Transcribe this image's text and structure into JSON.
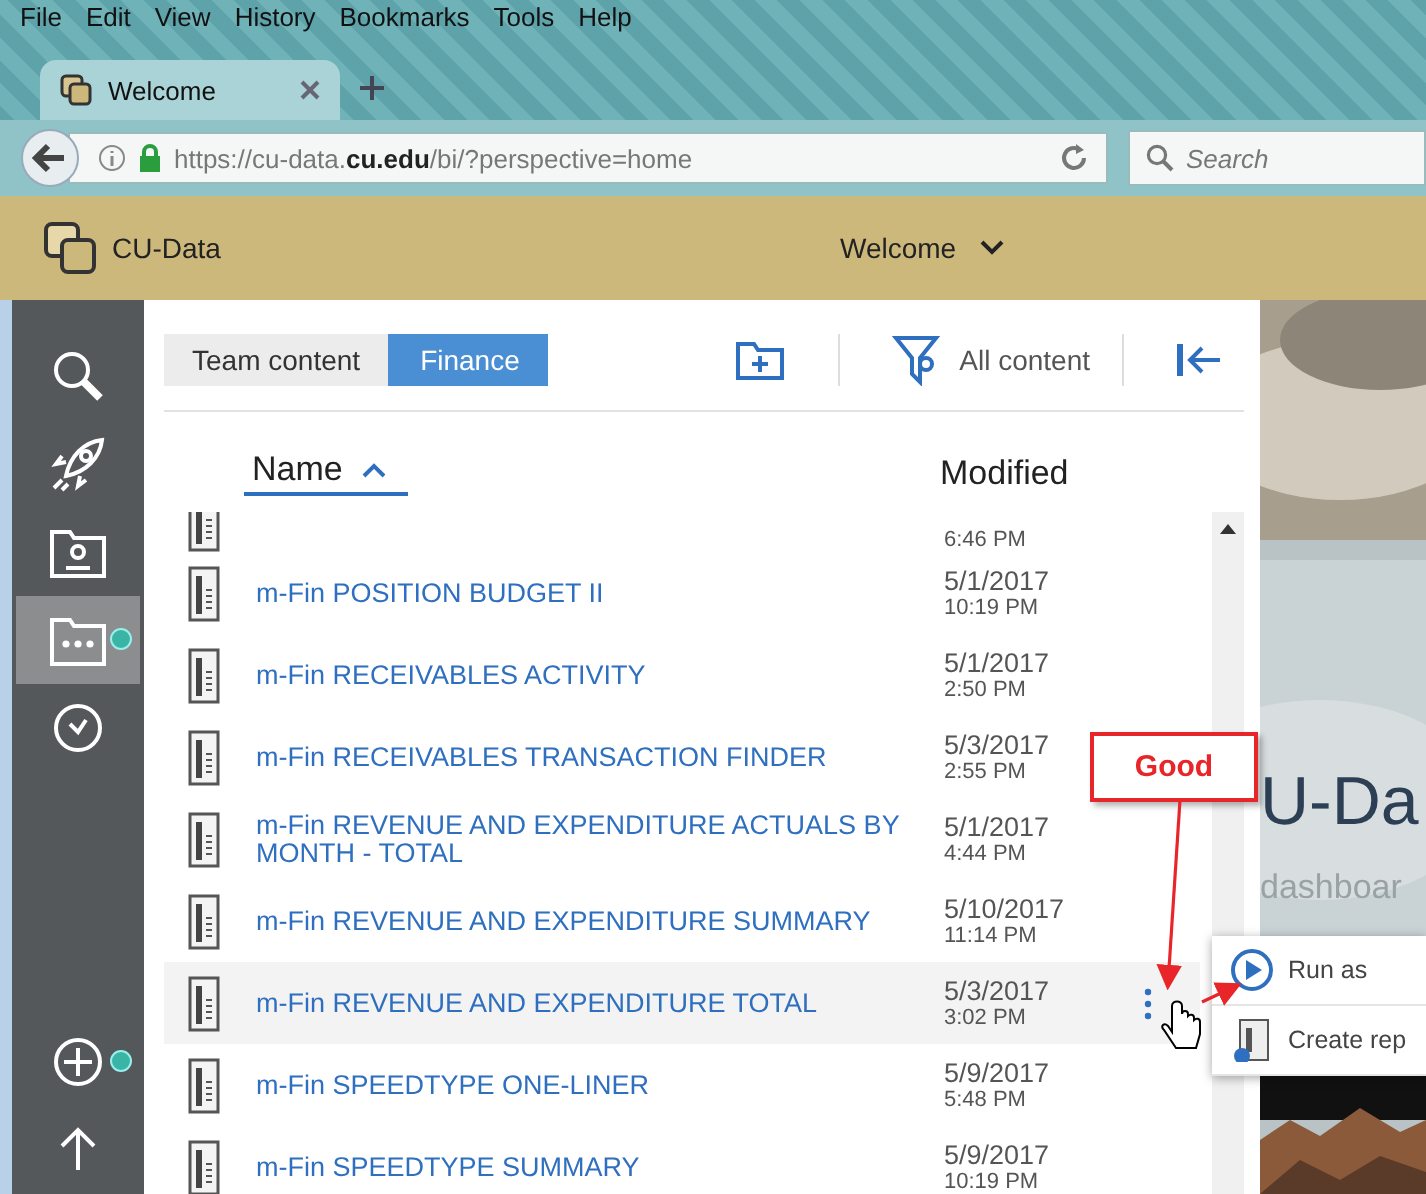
{
  "browser": {
    "menu": [
      "File",
      "Edit",
      "View",
      "History",
      "Bookmarks",
      "Tools",
      "Help"
    ],
    "tab": {
      "title": "Welcome"
    },
    "url": "https://cu-data.**cu.edu**/bi/?perspective=home",
    "search": {
      "placeholder": "Search"
    }
  },
  "app_header": {
    "brand": "CU-Data",
    "perspective": "Welcome"
  },
  "rail": {
    "items": [
      {
        "kind": "search",
        "selected": false,
        "badge": false
      },
      {
        "kind": "rocket",
        "selected": false,
        "badge": false
      },
      {
        "kind": "my-content",
        "selected": false,
        "badge": false
      },
      {
        "kind": "team-content",
        "selected": true,
        "badge": true
      },
      {
        "kind": "recent",
        "selected": false,
        "badge": false
      }
    ],
    "bottom_items": [
      {
        "kind": "new",
        "selected": false,
        "badge": true
      },
      {
        "kind": "upload",
        "selected": false,
        "badge": false
      }
    ]
  },
  "breadcrumb": [
    {
      "label": "Team content",
      "selected": false
    },
    {
      "label": "Finance",
      "selected": true
    }
  ],
  "toolbar": {
    "filter_label": "All content"
  },
  "columns": [
    "Name",
    "Modified"
  ],
  "rows": [
    {
      "time": "6:46 PM",
      "hovered": false
    },
    {
      "name": "m-Fin POSITION BUDGET II",
      "date": "5/1/2017",
      "time": "10:19 PM",
      "hovered": false
    },
    {
      "name": "m-Fin RECEIVABLES ACTIVITY",
      "date": "5/1/2017",
      "time": "2:50 PM",
      "hovered": false
    },
    {
      "name": "m-Fin RECEIVABLES TRANSACTION FINDER",
      "date": "5/3/2017",
      "time": "2:55 PM",
      "hovered": false
    },
    {
      "name": "m-Fin REVENUE AND EXPENDITURE ACTUALS BY MONTH - TOTAL",
      "date": "5/1/2017",
      "time": "4:44 PM",
      "hovered": false
    },
    {
      "name": "m-Fin REVENUE AND EXPENDITURE SUMMARY",
      "date": "5/10/2017",
      "time": "11:14 PM",
      "hovered": false
    },
    {
      "name": "m-Fin REVENUE AND EXPENDITURE TOTAL",
      "date": "5/3/2017",
      "time": "3:02 PM",
      "hovered": true
    },
    {
      "name": "m-Fin SPEEDTYPE ONE-LINER",
      "date": "5/9/2017",
      "time": "5:48 PM",
      "hovered": false
    },
    {
      "name": "m-Fin SPEEDTYPE SUMMARY",
      "date": "5/9/2017",
      "time": "10:19 PM",
      "hovered": false
    }
  ],
  "context_menu": [
    {
      "kind": "run",
      "label": "Run as"
    },
    {
      "kind": "create",
      "label": "Create rep"
    }
  ],
  "welcome": {
    "title": "U-Da",
    "subtitle": "dashboar"
  },
  "annotation": {
    "label": "Good"
  }
}
